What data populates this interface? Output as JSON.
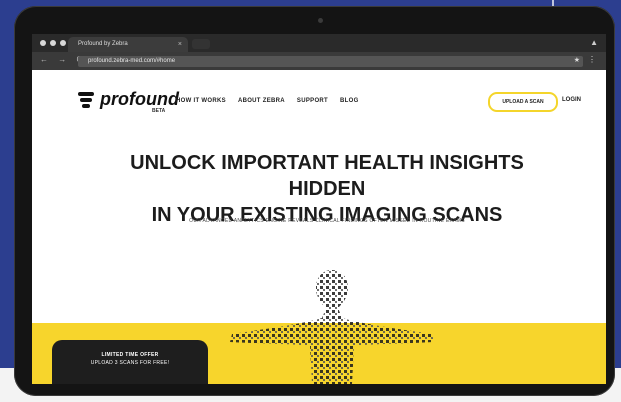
{
  "browser": {
    "tab_title": "Profound by Zebra",
    "tab_close": "×",
    "url": "profound.zebra-med.com/#home",
    "nav_arrows": "← → C",
    "star": "★",
    "menu": "⋮",
    "user": "▲"
  },
  "site": {
    "logo_text": "profound",
    "logo_beta": "BETA",
    "nav": [
      "HOW IT WORKS",
      "ABOUT ZEBRA",
      "SUPPORT",
      "BLOG"
    ],
    "upload_button": "UPLOAD A SCAN",
    "login": "LOGIN",
    "headline_line1": "UNLOCK IMPORTANT HEALTH INSIGHTS HIDDEN",
    "headline_line2": "IN YOUR EXISTING IMAGING SCANS",
    "subheadline": "OUR ADVANCED ANALYTICS ENGINE REVEALS CLINICAL FINDINGS OFTEN MISSED IN ROUTINE EXAMS",
    "offer_title": "LIMITED TIME OFFER",
    "offer_subtitle": "UPLOAD 3 SCANS FOR FREE!"
  },
  "colors": {
    "accent_yellow": "#f7d52c",
    "page_bg": "#ffffff",
    "laptop_frame": "#141414",
    "background_blue": "#2c3e8f"
  }
}
